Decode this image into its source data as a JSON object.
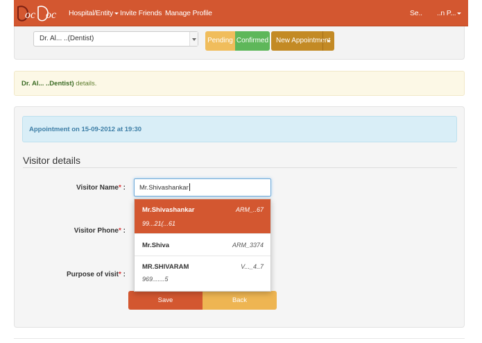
{
  "navbar": {
    "brand": "DocDoc",
    "items": [
      {
        "label": "Hospital/Entity",
        "has_caret": true
      },
      {
        "label": "Invite Friends",
        "has_caret": false
      },
      {
        "label": "Manage Profile",
        "has_caret": false
      }
    ],
    "right_items": [
      {
        "label": "Se..",
        "has_caret": false
      },
      {
        "label": "..n P...",
        "has_caret": true
      }
    ],
    "color": "#d35730"
  },
  "toolbar": {
    "doctor_select_value": "Dr. Al...  ..(Dentist)",
    "pending_label": "Pending",
    "confirmed_label": "Confirmed",
    "new_appointment_label": "New Appointment"
  },
  "doctor_alert": {
    "name": "Dr. Al...  ..Dentist)",
    "suffix": " details."
  },
  "appointment": {
    "info": "Appointment on 15-09-2012 at 19:30"
  },
  "visitor_form": {
    "section_title": "Visitor details",
    "name_label": "Visitor Name",
    "phone_label": "Visitor Phone",
    "purpose_label": "Purpose of visit",
    "required_mark": "*",
    "label_suffix": " :",
    "name_value": "Mr.Shivashankar",
    "save_label": "Save",
    "back_label": "Back"
  },
  "autocomplete": {
    "items": [
      {
        "name": "Mr.Shivashankar",
        "id": "ARM_..67",
        "phone": "99...21(...61",
        "active": true
      },
      {
        "name": "Mr.Shiva",
        "id": "ARM_3374",
        "phone": "",
        "active": false
      },
      {
        "name": "MR.SHIVARAM",
        "id": "V..._4..7",
        "phone": "969.......5",
        "active": false
      }
    ]
  },
  "colors": {
    "accent": "#d35730",
    "pending": "#f0bd5c",
    "confirmed": "#5eb75a",
    "new_appointment": "#c38a25",
    "back": "#eeb552",
    "info_bg": "#d9eef7"
  }
}
